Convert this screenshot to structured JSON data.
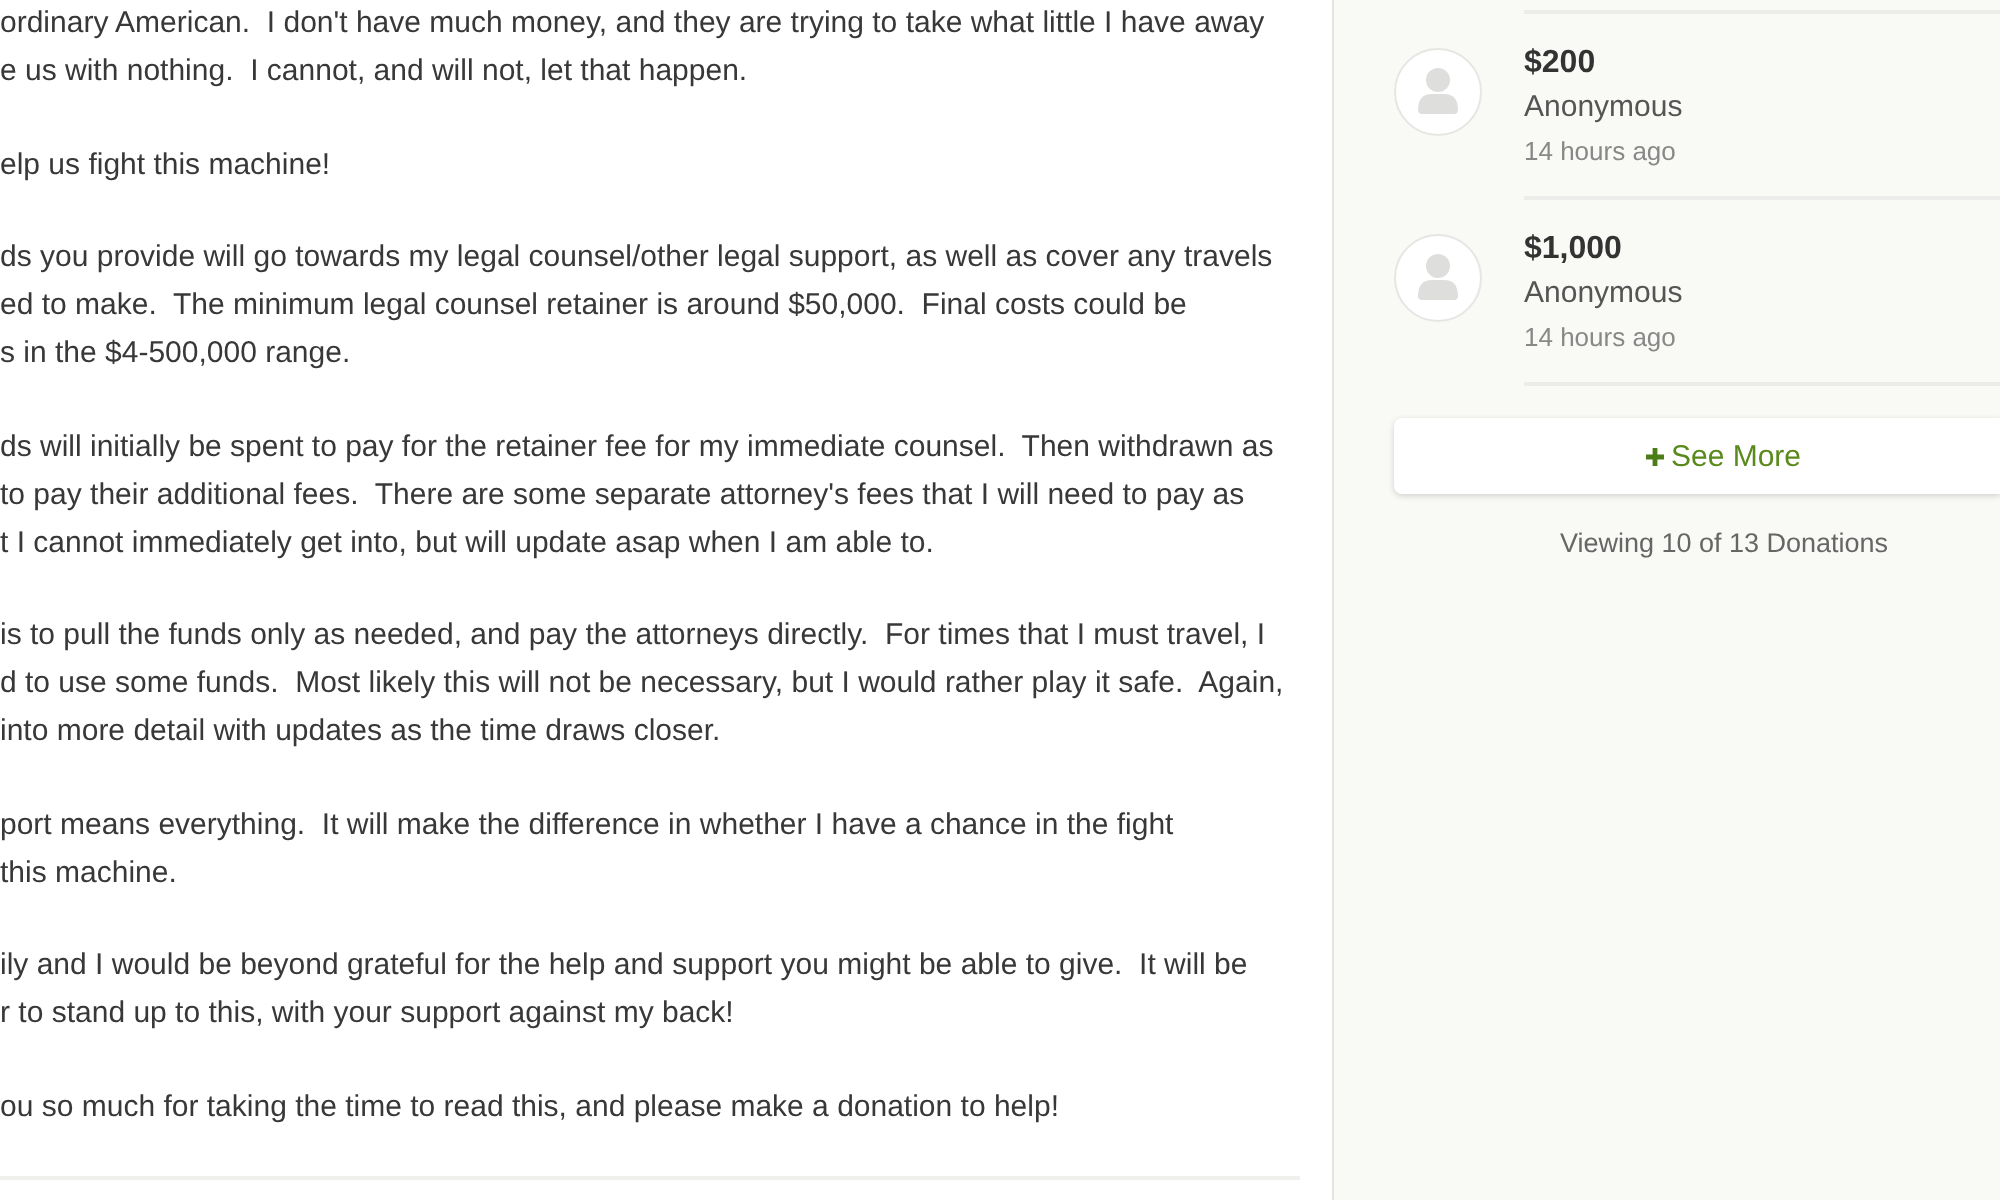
{
  "story": {
    "paragraphs": [
      {
        "lines": [
          "ordinary American.  I don't have much money, and they are trying to take what little I have away",
          "e us with nothing.  I cannot, and will not, let that happen."
        ]
      },
      {
        "lines": [
          "elp us fight this machine!"
        ]
      },
      {
        "lines": [
          "ds you provide will go towards my legal counsel/other legal support, as well as cover any travels",
          "ed to make.  The minimum legal counsel retainer is around $50,000.  Final costs could be",
          "s in the $4-500,000 range."
        ]
      },
      {
        "lines": [
          "ds will initially be spent to pay for the retainer fee for my immediate counsel.  Then withdrawn as",
          "to pay their additional fees.  There are some separate attorney's fees that I will need to pay as",
          "t I cannot immediately get into, but will update asap when I am able to."
        ]
      },
      {
        "lines": [
          "is to pull the funds only as needed, and pay the attorneys directly.  For times that I must travel, I",
          "d to use some funds.  Most likely this will not be necessary, but I would rather play it safe.  Again,",
          "into more detail with updates as the time draws closer."
        ]
      },
      {
        "lines": [
          "port means everything.  It will make the difference in whether I have a chance in the fight",
          "this machine."
        ]
      },
      {
        "lines": [
          "ily and I would be beyond grateful for the help and support you might be able to give.  It will be",
          "r to stand up to this, with your support against my back!"
        ]
      },
      {
        "lines": [
          "ou so much for taking the time to read this, and please make a donation to help!"
        ]
      }
    ]
  },
  "donations": {
    "items": [
      {
        "amount": "$200",
        "name": "Anonymous",
        "time": "14 hours ago"
      },
      {
        "amount": "$1,000",
        "name": "Anonymous",
        "time": "14 hours ago"
      }
    ],
    "see_more": {
      "label": "See More"
    },
    "summary": "Viewing 10 of 13 Donations"
  }
}
